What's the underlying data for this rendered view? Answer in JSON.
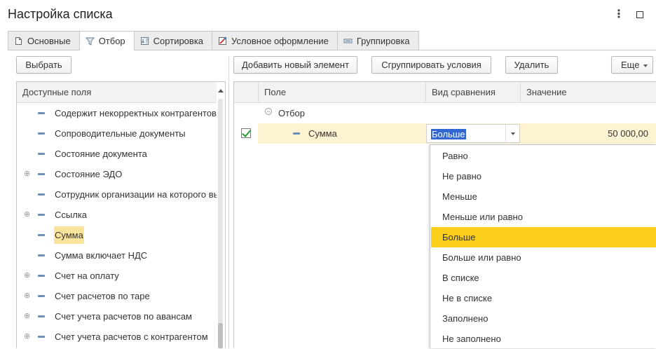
{
  "window": {
    "title": "Настройка списка",
    "menu_icon": "kebab-icon",
    "maximize_icon": "maximize-icon"
  },
  "tabs": [
    {
      "label": "Основные",
      "icon": "document-icon",
      "active": false
    },
    {
      "label": "Отбор",
      "icon": "filter-icon",
      "active": true
    },
    {
      "label": "Сортировка",
      "icon": "sort-icon",
      "active": false
    },
    {
      "label": "Условное оформление",
      "icon": "conditional-format-icon",
      "active": false
    },
    {
      "label": "Группировка",
      "icon": "grouping-icon",
      "active": false
    }
  ],
  "toolbar": {
    "select_label": "Выбрать",
    "add_label": "Добавить новый элемент",
    "group_label": "Сгруппировать условия",
    "delete_label": "Удалить",
    "more_label": "Еще"
  },
  "fields": {
    "header": "Доступные поля",
    "items": [
      {
        "label": "Содержит некорректных контрагентов",
        "expandable": false,
        "selected": false
      },
      {
        "label": "Сопроводительные документы",
        "expandable": false,
        "selected": false
      },
      {
        "label": "Состояние документа",
        "expandable": false,
        "selected": false
      },
      {
        "label": "Состояние ЭДО",
        "expandable": true,
        "selected": false
      },
      {
        "label": "Сотрудник организации на которого вы",
        "expandable": false,
        "selected": false
      },
      {
        "label": "Ссылка",
        "expandable": true,
        "selected": false
      },
      {
        "label": "Сумма",
        "expandable": false,
        "selected": true
      },
      {
        "label": "Сумма включает НДС",
        "expandable": false,
        "selected": false
      },
      {
        "label": "Счет на оплату",
        "expandable": true,
        "selected": false
      },
      {
        "label": "Счет расчетов по таре",
        "expandable": true,
        "selected": false
      },
      {
        "label": "Счет учета расчетов по авансам",
        "expandable": true,
        "selected": false
      },
      {
        "label": "Счет учета расчетов с контрагентом",
        "expandable": true,
        "selected": false
      }
    ]
  },
  "filter": {
    "columns": {
      "field": "Поле",
      "comparison": "Вид сравнения",
      "value": "Значение"
    },
    "group_label": "Отбор",
    "row": {
      "field": "Сумма",
      "comparison": "Больше",
      "value": "50 000,00",
      "checked": true
    }
  },
  "comparison_options": [
    {
      "label": "Равно",
      "selected": false
    },
    {
      "label": "Не равно",
      "selected": false
    },
    {
      "label": "Меньше",
      "selected": false
    },
    {
      "label": "Меньше или равно",
      "selected": false
    },
    {
      "label": "Больше",
      "selected": true
    },
    {
      "label": "Больше или равно",
      "selected": false
    },
    {
      "label": "В списке",
      "selected": false
    },
    {
      "label": "Не в списке",
      "selected": false
    },
    {
      "label": "Заполнено",
      "selected": false
    },
    {
      "label": "Не заполнено",
      "selected": false
    }
  ],
  "colors": {
    "selected_field": "#fbe49c",
    "selected_option": "#fbce1c",
    "row_highlight": "#fdf3d2",
    "editor_selection": "#3067d3",
    "check": "#2a9d3a"
  }
}
